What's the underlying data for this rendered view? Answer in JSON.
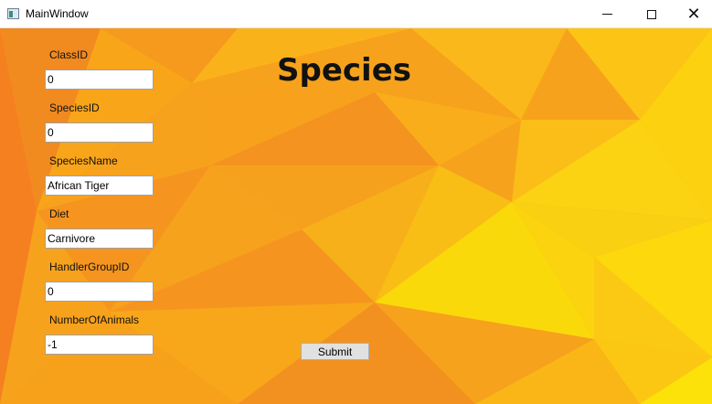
{
  "window": {
    "title": "MainWindow",
    "icon": "app-window-icon",
    "minimize_icon": "minimize-icon",
    "maximize_icon": "maximize-icon",
    "close_icon": "close-icon"
  },
  "page": {
    "title": "Species"
  },
  "form": {
    "fields": [
      {
        "label": "ClassID",
        "value": "0"
      },
      {
        "label": "SpeciesID",
        "value": "0"
      },
      {
        "label": "SpeciesName",
        "value": "African Tiger"
      },
      {
        "label": "Diet",
        "value": "Carnivore"
      },
      {
        "label": "HandlerGroupID",
        "value": "0"
      },
      {
        "label": "NumberOfAnimals",
        "value": "-1"
      }
    ],
    "submit_label": "Submit"
  },
  "colors": {
    "background_orange": "#f7a21c",
    "background_yellow": "#f9d60a"
  }
}
